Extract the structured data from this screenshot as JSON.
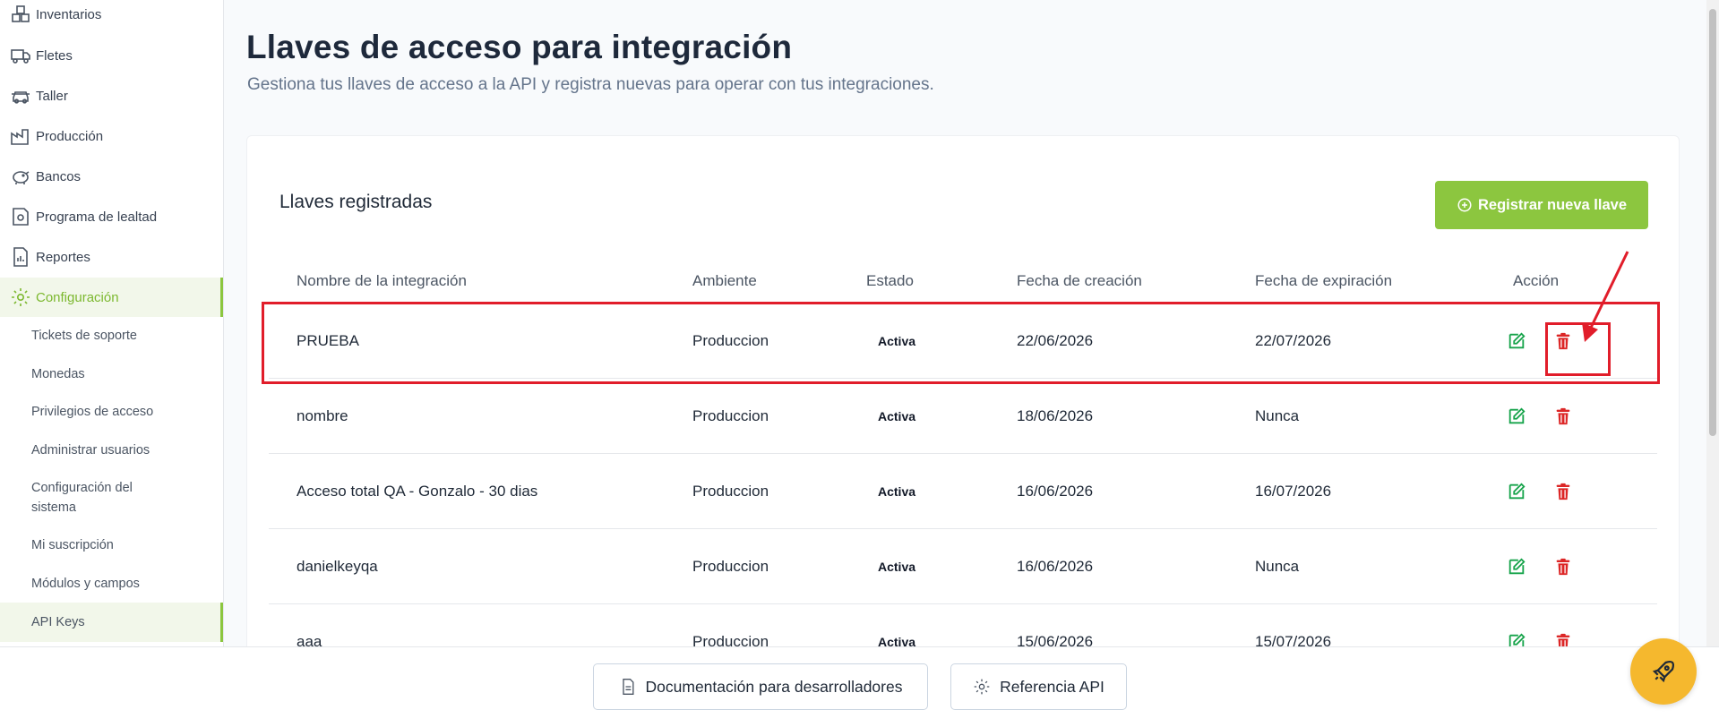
{
  "sidebar": {
    "items": [
      {
        "label": "Inventarios",
        "icon": "boxes-icon"
      },
      {
        "label": "Fletes",
        "icon": "truck-icon"
      },
      {
        "label": "Taller",
        "icon": "car-icon"
      },
      {
        "label": "Producción",
        "icon": "factory-icon"
      },
      {
        "label": "Bancos",
        "icon": "piggy-bank-icon"
      },
      {
        "label": "Programa de lealtad",
        "icon": "loyalty-icon"
      },
      {
        "label": "Reportes",
        "icon": "report-icon"
      },
      {
        "label": "Configuración",
        "icon": "gear-icon",
        "active": true
      }
    ],
    "sub_items": [
      "Tickets de soporte",
      "Monedas",
      "Privilegios de acceso",
      "Administrar usuarios",
      "Configuración del sistema",
      "Mi suscripción",
      "Módulos y campos",
      "API Keys"
    ]
  },
  "page": {
    "title": "Llaves de acceso para integración",
    "subtitle": "Gestiona tus llaves de acceso a la API y registra nuevas para operar con tus integraciones."
  },
  "card": {
    "title": "Llaves registradas",
    "new_button": "Registrar nueva llave"
  },
  "table": {
    "headers": [
      "Nombre de la integración",
      "Ambiente",
      "Estado",
      "Fecha de creación",
      "Fecha de expiración",
      "Acción"
    ],
    "rows": [
      {
        "name": "PRUEBA",
        "env": "Produccion",
        "status": "Activa",
        "created": "22/06/2026",
        "expires": "22/07/2026"
      },
      {
        "name": "nombre",
        "env": "Produccion",
        "status": "Activa",
        "created": "18/06/2026",
        "expires": "Nunca"
      },
      {
        "name": "Acceso total QA - Gonzalo - 30 dias",
        "env": "Produccion",
        "status": "Activa",
        "created": "16/06/2026",
        "expires": "16/07/2026"
      },
      {
        "name": "danielkeyqa",
        "env": "Produccion",
        "status": "Activa",
        "created": "16/06/2026",
        "expires": "Nunca"
      },
      {
        "name": "aaa",
        "env": "Produccion",
        "status": "Activa",
        "created": "15/06/2026",
        "expires": "15/07/2026"
      }
    ]
  },
  "footer": {
    "docs_button": "Documentación para desarrolladores",
    "api_button": "Referencia API"
  },
  "colors": {
    "accent": "#8cc63f",
    "edit": "#16a34a",
    "delete": "#dc2626",
    "highlight": "#e11d2a",
    "rocket": "#f5b82e"
  }
}
